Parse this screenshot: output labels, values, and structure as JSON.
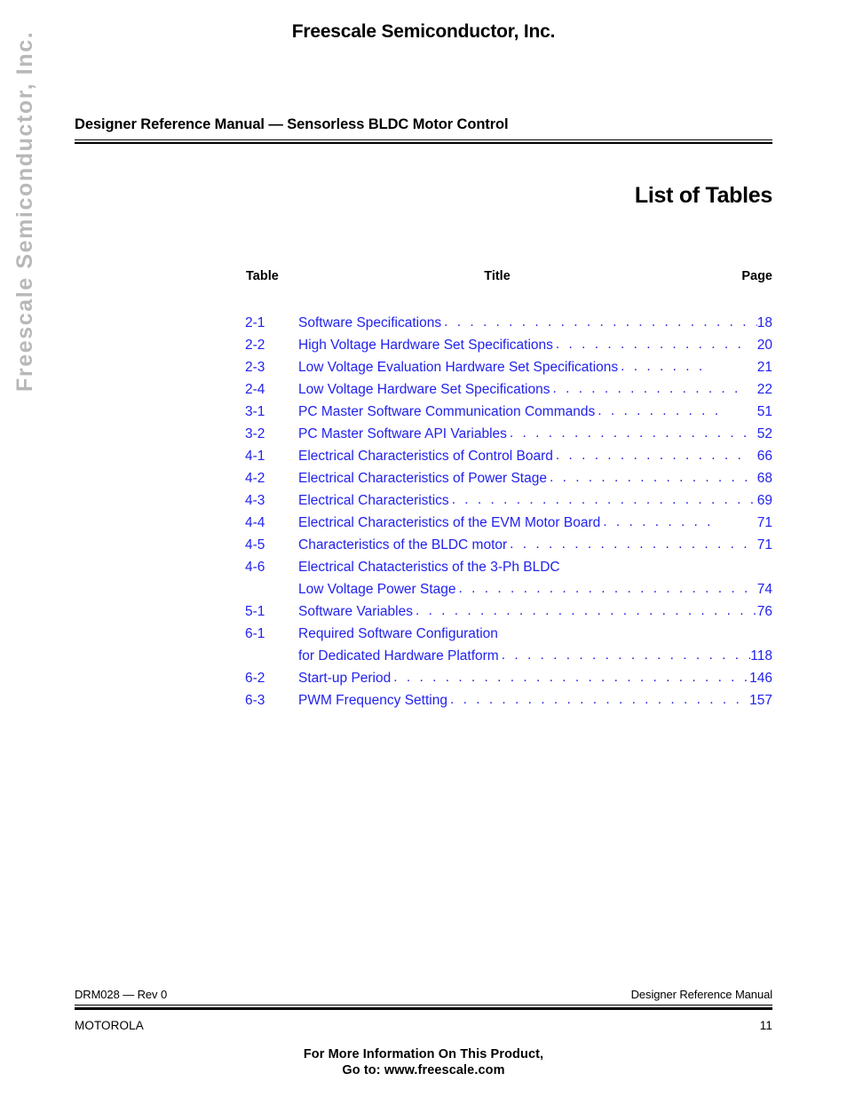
{
  "watermark": {
    "text": "Freescale Semiconductor, Inc.",
    "color": "#b8b8b8"
  },
  "top_banner": {
    "text": "Freescale Semiconductor, Inc."
  },
  "header": {
    "title": "Designer Reference Manual — Sensorless BLDC Motor Control"
  },
  "page_heading": {
    "text": "List of Tables"
  },
  "toc": {
    "accent_color": "#2222ee",
    "columns": {
      "table": "Table",
      "title": "Title",
      "page": "Page"
    },
    "entries": [
      {
        "num": "2-1",
        "title": "Software Specifications",
        "leader": " . . . . . . . . . . . . . . . . . . . . . . . . . . . .",
        "page": "18"
      },
      {
        "num": "2-2",
        "title": "High Voltage Hardware Set Specifications",
        "leader": ". . . . . . . . . . . . . . .",
        "page": "20"
      },
      {
        "num": "2-3",
        "title": "Low Voltage Evaluation Hardware Set Specifications",
        "leader": " . . . . . . .",
        "page": "21"
      },
      {
        "num": "2-4",
        "title": "Low Voltage Hardware Set Specifications",
        "leader": " . . . . . . . . . . . . . . .",
        "page": "22"
      },
      {
        "num": "3-1",
        "title": "PC Master Software Communication Commands",
        "leader": " . . . . . . . . . .",
        "page": "51"
      },
      {
        "num": "3-2",
        "title": "PC Master Software API Variables",
        "leader": ". . . . . . . . . . . . . . . . . . . . .",
        "page": "52"
      },
      {
        "num": "4-1",
        "title": "Electrical Characteristics of Control Board",
        "leader": " . . . . . . . . . . . . . . .",
        "page": "66"
      },
      {
        "num": "4-2",
        "title": "Electrical Characteristics of Power Stage",
        "leader": ". . . . . . . . . . . . . . . .",
        "page": "68"
      },
      {
        "num": "4-3",
        "title": "Electrical Characteristics",
        "leader": " . . . . . . . . . . . . . . . . . . . . . . . . . . .",
        "page": "69"
      },
      {
        "num": "4-4",
        "title": "Electrical Characteristics of the EVM Motor Board",
        "leader": ". . . . . . . . .",
        "page": "71"
      },
      {
        "num": "4-5",
        "title": "Characteristics of the BLDC motor",
        "leader": " . . . . . . . . . . . . . . . . . . . . .",
        "page": "71"
      },
      {
        "num": "4-6",
        "title": "Electrical Chatacteristics of the 3-Ph BLDC",
        "leader": "",
        "page": ""
      },
      {
        "num": "",
        "title": "Low Voltage Power Stage",
        "leader": " . . . . . . . . . . . . . . . . . . . . . . . . . . .",
        "page": "74",
        "continuation": true
      },
      {
        "num": "5-1",
        "title": "Software Variables",
        "leader": " . . . . . . . . . . . . . . . . . . . . . . . . . . . . . . .",
        "page": "76"
      },
      {
        "num": "6-1",
        "title": "Required Software Configuration",
        "leader": "",
        "page": ""
      },
      {
        "num": "",
        "title": "for Dedicated Hardware Platform",
        "leader": " . . . . . . . . . . . . . . . . . . . . . .",
        "page": "118",
        "continuation": true
      },
      {
        "num": "6-2",
        "title": "Start-up Period",
        "leader": " . . . . . . . . . . . . . . . . . . . . . . . . . . . . . . . . . .",
        "page": "146"
      },
      {
        "num": "6-3",
        "title": "PWM Frequency Setting",
        "leader": ". . . . . . . . . . . . . . . . . . . . . . . . . . . .",
        "page": "157"
      }
    ]
  },
  "footer": {
    "doc_id": "DRM028 — Rev 0",
    "manual_type": "Designer Reference Manual",
    "company": "MOTOROLA",
    "page_number": "11",
    "promo_line1": "For More Information On This Product,",
    "promo_line2": "Go to: www.freescale.com"
  }
}
